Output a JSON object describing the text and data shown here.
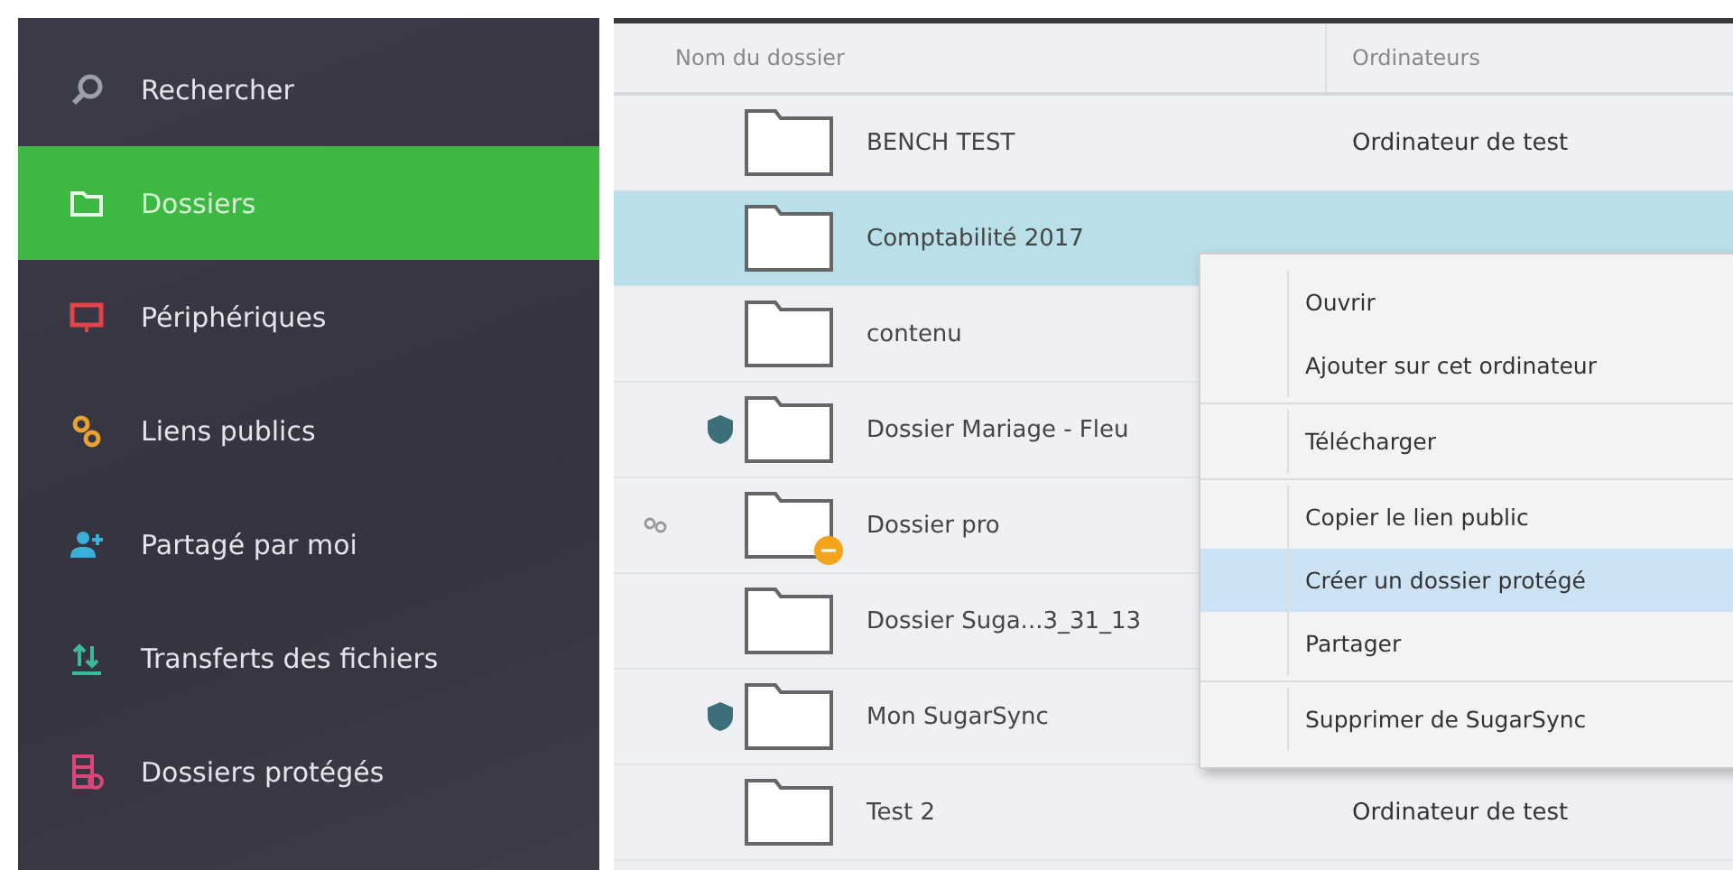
{
  "sidebar": {
    "items": [
      {
        "label": "Rechercher",
        "selected": false
      },
      {
        "label": "Dossiers",
        "selected": true
      },
      {
        "label": "Périphériques",
        "selected": false
      },
      {
        "label": "Liens publics",
        "selected": false
      },
      {
        "label": "Partagé par moi",
        "selected": false
      },
      {
        "label": "Transferts des fichiers",
        "selected": false
      },
      {
        "label": "Dossiers protégés",
        "selected": false
      }
    ]
  },
  "table": {
    "columns": [
      "Nom du dossier",
      "Ordinateurs"
    ],
    "rows": [
      {
        "name": "BENCH TEST",
        "computer": "Ordinateur de test",
        "protected": false,
        "public_link": false,
        "badge": false,
        "selected": false
      },
      {
        "name": "Comptabilité 2017",
        "protected": false,
        "public_link": false,
        "badge": false,
        "selected": true
      },
      {
        "name": "contenu",
        "protected": false,
        "public_link": false,
        "badge": false,
        "selected": false
      },
      {
        "name": "Dossier Mariage - Fleu",
        "protected": true,
        "public_link": false,
        "badge": false,
        "selected": false
      },
      {
        "name": "Dossier pro",
        "protected": false,
        "public_link": true,
        "badge": true,
        "selected": false
      },
      {
        "name": "Dossier Suga...3_31_13",
        "protected": false,
        "public_link": false,
        "badge": false,
        "selected": false
      },
      {
        "name": "Mon SugarSync",
        "protected": true,
        "public_link": false,
        "badge": false,
        "selected": false
      },
      {
        "name": "Test 2",
        "computer": "Ordinateur de test",
        "protected": false,
        "public_link": false,
        "badge": false,
        "selected": false
      }
    ]
  },
  "context_menu": {
    "groups": [
      [
        {
          "label": "Ouvrir",
          "selected": false
        },
        {
          "label": "Ajouter sur cet ordinateur",
          "selected": false
        }
      ],
      [
        {
          "label": "Télécharger",
          "selected": false
        }
      ],
      [
        {
          "label": "Copier le lien public",
          "selected": false
        },
        {
          "label": "Créer un dossier protégé",
          "selected": true
        },
        {
          "label": "Partager",
          "selected": false
        }
      ],
      [
        {
          "label": "Supprimer de SugarSync",
          "selected": false
        }
      ]
    ]
  }
}
